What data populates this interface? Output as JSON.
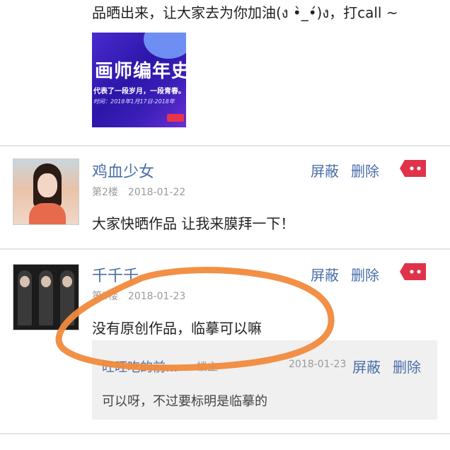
{
  "post": {
    "text": "品晒出来，让大家去为你加油(ง •̀_•́)ง，打call ~",
    "image": {
      "headline": "画师编年史",
      "subline": "代表了一段岁月，一段青春。",
      "dates": "时间：2018年1月17日-2018年"
    }
  },
  "comments": [
    {
      "user": "鸡血少女",
      "floor": "第2楼",
      "date": "2018-01-22",
      "text": "大家快晒作品 让我来膜拜一下！",
      "block_label": "屏蔽",
      "delete_label": "删除",
      "report_icon": "report-flag-icon"
    },
    {
      "user": "千千千",
      "floor": "第3楼",
      "date": "2018-01-23",
      "text": "没有原创作品，临摹可以嘛",
      "block_label": "屏蔽",
      "delete_label": "删除",
      "report_icon": "report-flag-icon",
      "reply": {
        "user": "旺旺吃的前...",
        "role": "楼主",
        "date": "2018-01-23",
        "block_label": "屏蔽",
        "delete_label": "删除",
        "text": "可以呀，不过要标明是临摹的"
      }
    }
  ],
  "colors": {
    "link": "#4a6ea9",
    "report": "#e0334a",
    "annotation": "#f08a3c"
  }
}
